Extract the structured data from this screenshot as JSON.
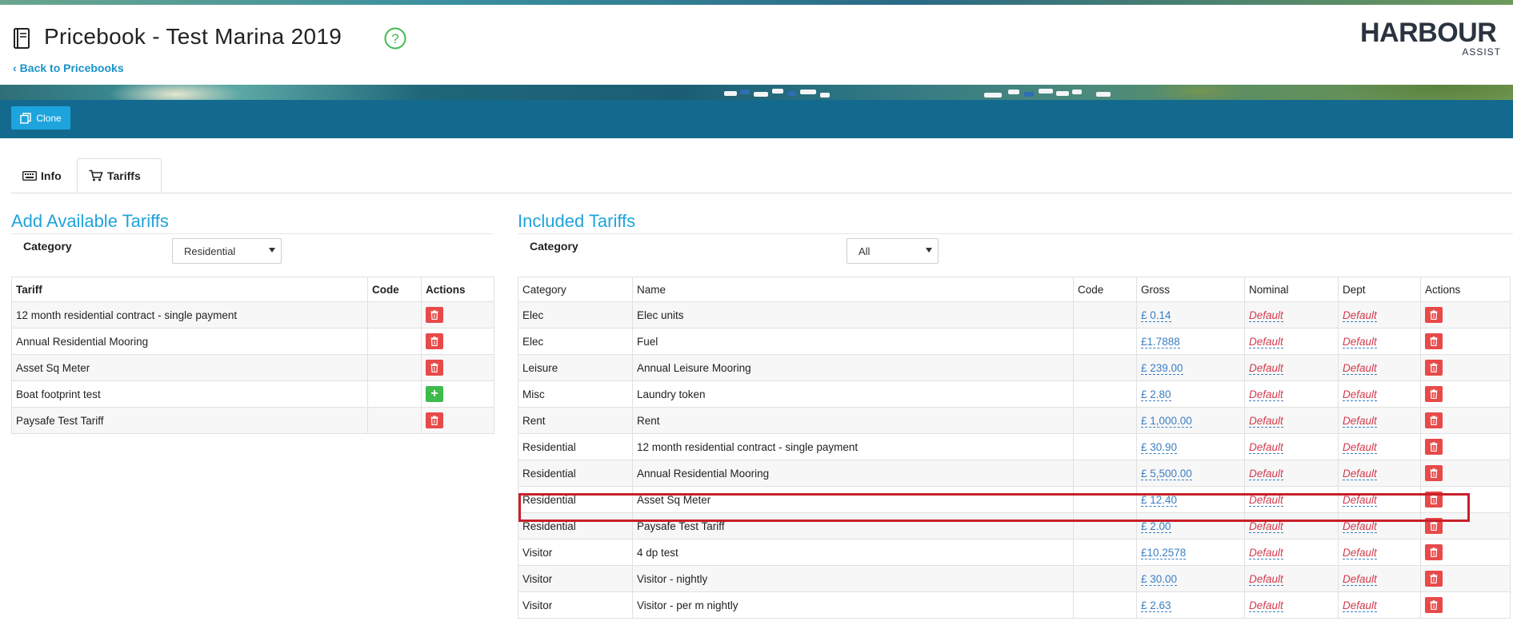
{
  "header": {
    "title": "Pricebook - Test Marina 2019",
    "back_label": "Back to Pricebooks",
    "logo_text": "HARBOUR",
    "logo_sub": "ASSIST"
  },
  "toolbar": {
    "clone_label": "Clone"
  },
  "tabs": [
    {
      "label": "Info",
      "icon": "keyboard-icon",
      "active": false
    },
    {
      "label": "Tariffs",
      "icon": "cart-icon",
      "active": true
    }
  ],
  "available": {
    "title": "Add Available Tariffs",
    "category_label": "Category",
    "category_value": "Residential",
    "columns": [
      "Tariff",
      "Code",
      "Actions"
    ],
    "rows": [
      {
        "tariff": "12 month residential contract - single payment",
        "code": "",
        "action": "delete"
      },
      {
        "tariff": "Annual Residential Mooring",
        "code": "",
        "action": "delete"
      },
      {
        "tariff": "Asset Sq Meter",
        "code": "",
        "action": "delete"
      },
      {
        "tariff": "Boat footprint test",
        "code": "",
        "action": "add"
      },
      {
        "tariff": "Paysafe Test Tariff",
        "code": "",
        "action": "delete"
      }
    ]
  },
  "included": {
    "title": "Included Tariffs",
    "category_label": "Category",
    "category_value": "All",
    "columns": [
      "Category",
      "Name",
      "Code",
      "Gross",
      "Nominal",
      "Dept",
      "Actions"
    ],
    "rows": [
      {
        "category": "Elec",
        "name": "Elec units",
        "code": "",
        "gross": "£ 0.14",
        "nominal": "Default",
        "dept": "Default"
      },
      {
        "category": "Elec",
        "name": "Fuel",
        "code": "",
        "gross": "£1.7888",
        "nominal": "Default",
        "dept": "Default"
      },
      {
        "category": "Leisure",
        "name": "Annual Leisure Mooring",
        "code": "",
        "gross": "£ 239.00",
        "nominal": "Default",
        "dept": "Default"
      },
      {
        "category": "Misc",
        "name": "Laundry token",
        "code": "",
        "gross": "£ 2.80",
        "nominal": "Default",
        "dept": "Default"
      },
      {
        "category": "Rent",
        "name": "Rent",
        "code": "",
        "gross": "£ 1,000.00",
        "nominal": "Default",
        "dept": "Default"
      },
      {
        "category": "Residential",
        "name": "12 month residential contract - single payment",
        "code": "",
        "gross": "£ 30.90",
        "nominal": "Default",
        "dept": "Default"
      },
      {
        "category": "Residential",
        "name": "Annual Residential Mooring",
        "code": "",
        "gross": "£ 5,500.00",
        "nominal": "Default",
        "dept": "Default"
      },
      {
        "category": "Residential",
        "name": "Asset Sq Meter",
        "code": "",
        "gross": "£ 12.40",
        "nominal": "Default",
        "dept": "Default"
      },
      {
        "category": "Residential",
        "name": "Paysafe Test Tariff",
        "code": "",
        "gross": "£ 2.00",
        "nominal": "Default",
        "dept": "Default"
      },
      {
        "category": "Visitor",
        "name": "4 dp test",
        "code": "",
        "gross": "£10.2578",
        "nominal": "Default",
        "dept": "Default"
      },
      {
        "category": "Visitor",
        "name": "Visitor - nightly",
        "code": "",
        "gross": "£ 30.00",
        "nominal": "Default",
        "dept": "Default"
      },
      {
        "category": "Visitor",
        "name": "Visitor - per m nightly",
        "code": "",
        "gross": "£ 2.63",
        "nominal": "Default",
        "dept": "Default"
      }
    ]
  },
  "colors": {
    "accent": "#1fa3dc",
    "toolbar": "#136a8e",
    "danger": "#e84a4a",
    "success": "#3fba4d",
    "highlight": "#c8202a"
  }
}
